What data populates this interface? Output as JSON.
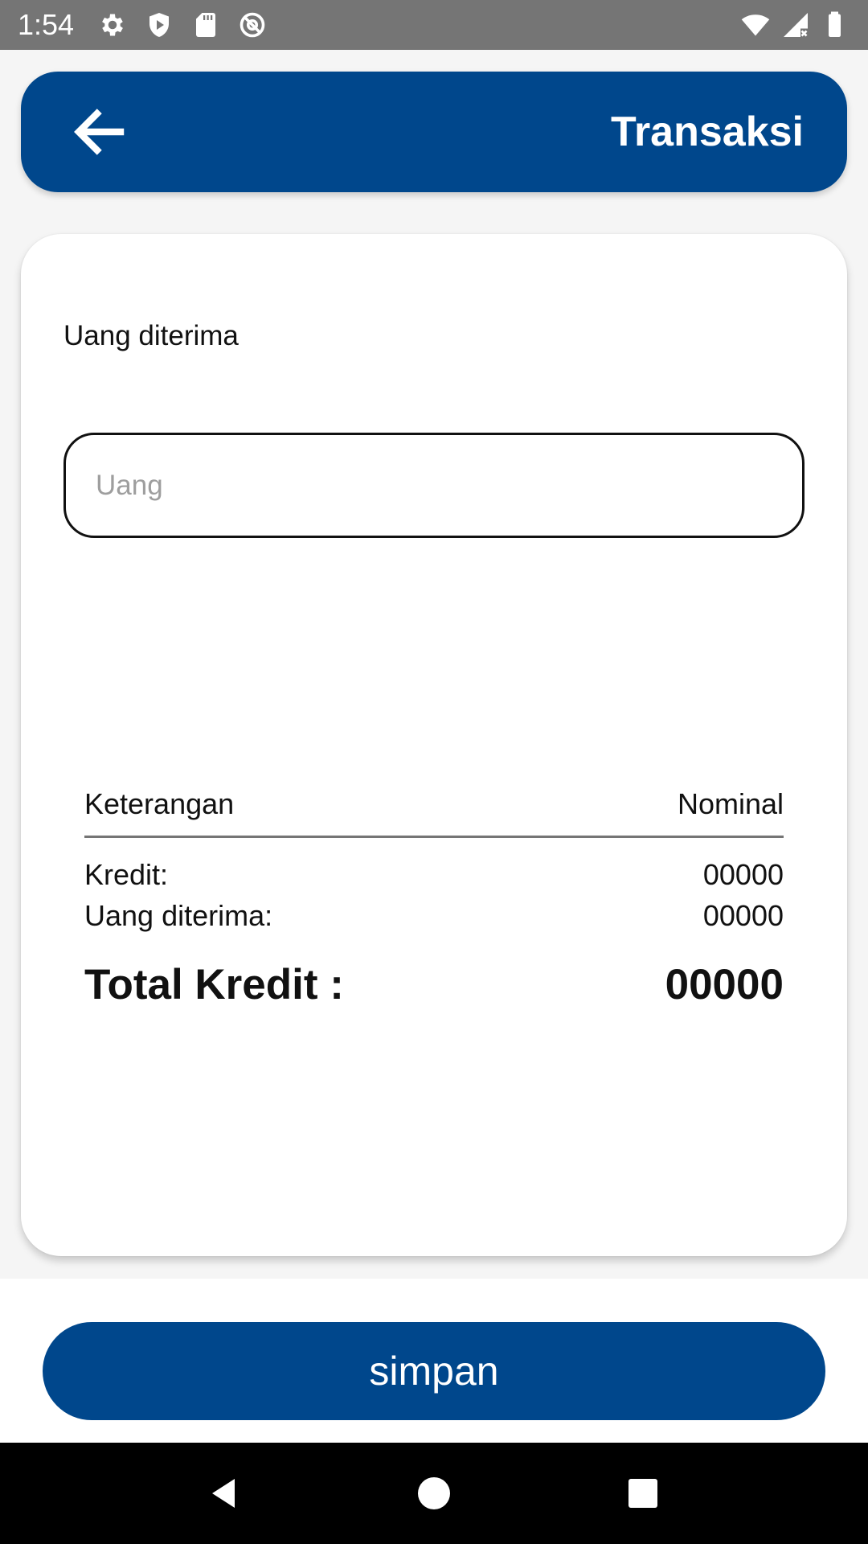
{
  "status_bar": {
    "time": "1:54",
    "left_icons": [
      "settings-icon",
      "shield-play-icon",
      "sd-card-icon",
      "no-signal-at-icon"
    ],
    "right_icons": [
      "wifi-icon",
      "cell-signal-icon",
      "battery-icon"
    ]
  },
  "app_bar": {
    "title": "Transaksi",
    "back_icon": "arrow-left-icon",
    "color": "#00478c"
  },
  "form": {
    "label": "Uang diterima",
    "input_placeholder": "Uang",
    "input_value": ""
  },
  "summary": {
    "header": {
      "left": "Keterangan",
      "right": "Nominal"
    },
    "rows": [
      {
        "label": "Kredit:",
        "value": "00000"
      },
      {
        "label": "Uang diterima:",
        "value": "00000"
      }
    ],
    "total": {
      "label": "Total Kredit :",
      "value": "00000"
    }
  },
  "footer": {
    "save_label": "simpan",
    "button_color": "#00478c"
  },
  "nav": {
    "icons": [
      "back-triangle-icon",
      "home-circle-icon",
      "recents-square-icon"
    ]
  }
}
